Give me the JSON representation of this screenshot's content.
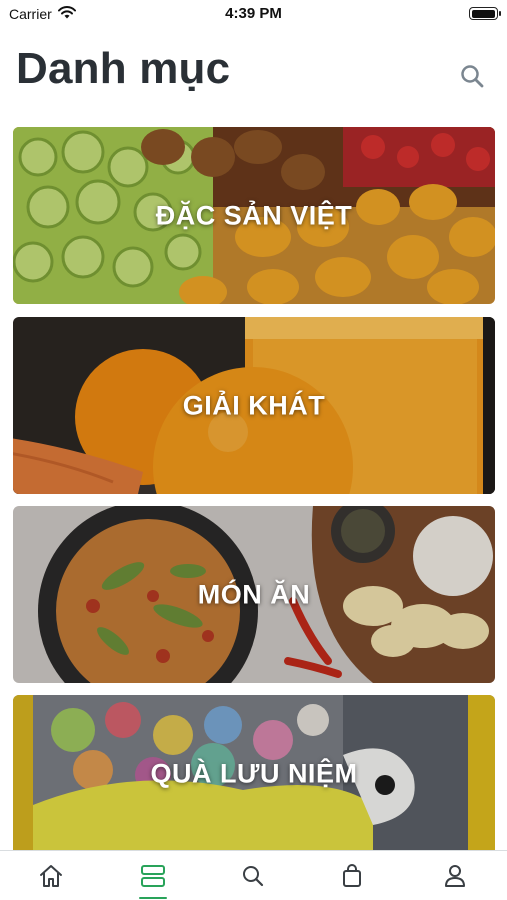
{
  "status_bar": {
    "carrier": "Carrier",
    "time": "4:39 PM",
    "battery_level": 1.0
  },
  "header": {
    "title": "Danh mục",
    "search_icon": "search-icon"
  },
  "categories": [
    {
      "label": "ĐẶC SẢN VIỆT",
      "image": "dried-fruits-photo"
    },
    {
      "label": "GIẢI KHÁT",
      "image": "oranges-juice-photo"
    },
    {
      "label": "MÓN ĂN",
      "image": "curry-dish-photo"
    },
    {
      "label": "QUÀ LƯU NIỆM",
      "image": "plush-toys-photo"
    }
  ],
  "tab_bar": {
    "tabs": [
      {
        "icon": "home-icon",
        "active": false
      },
      {
        "icon": "categories-icon",
        "active": true
      },
      {
        "icon": "search-icon",
        "active": false
      },
      {
        "icon": "bag-icon",
        "active": false
      },
      {
        "icon": "profile-icon",
        "active": false
      }
    ],
    "active_color": "#29a35a",
    "inactive_color": "#3a3f44"
  }
}
